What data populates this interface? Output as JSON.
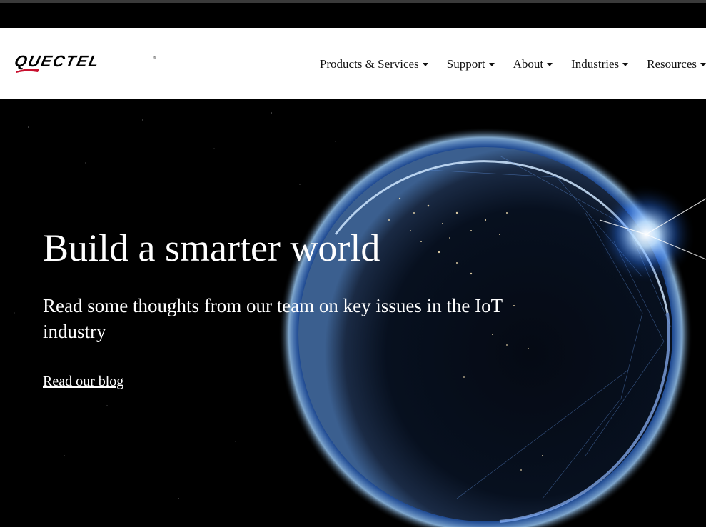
{
  "logo": {
    "text": "QUECTEL"
  },
  "nav": {
    "items": [
      {
        "label": "Products & Services"
      },
      {
        "label": "Support"
      },
      {
        "label": "About"
      },
      {
        "label": "Industries"
      },
      {
        "label": "Resources"
      }
    ]
  },
  "hero": {
    "title": "Build a smarter world",
    "subtitle": "Read some thoughts from our team on key issues in the IoT industry",
    "link_label": "Read our blog"
  },
  "colors": {
    "logo_red": "#c8102e",
    "hero_glow": "#2e7bff"
  }
}
